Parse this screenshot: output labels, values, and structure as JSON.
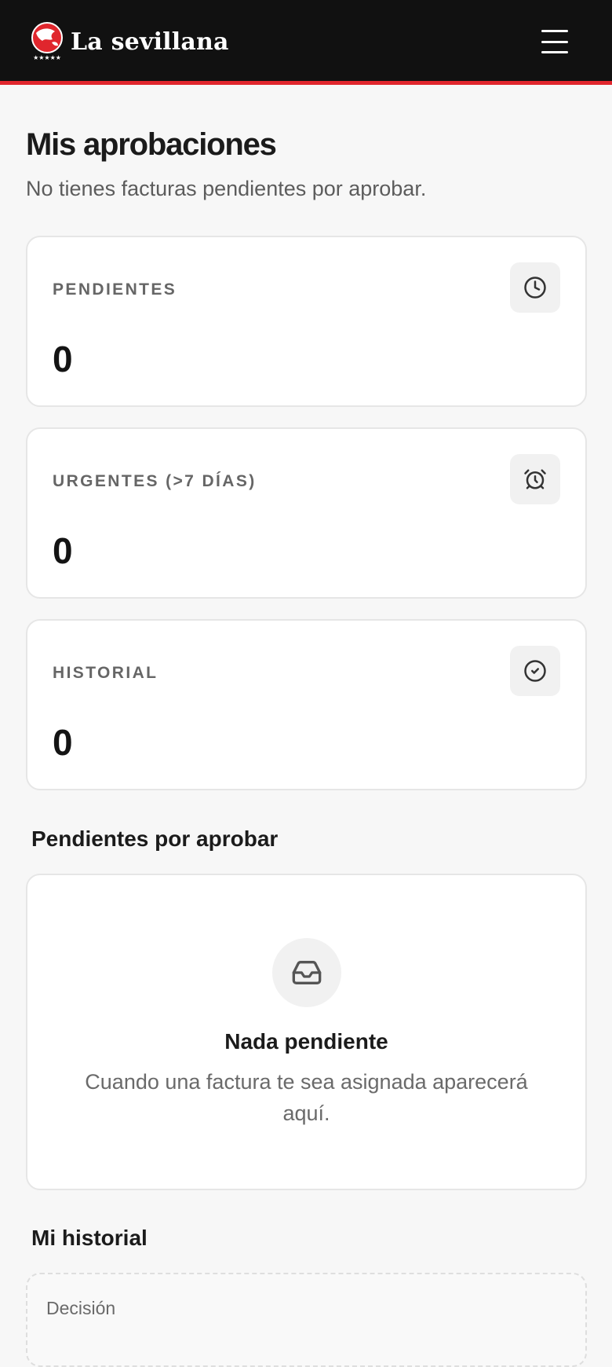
{
  "header": {
    "brand": "La sevillana",
    "colors": {
      "bar": "#111111",
      "accent": "#e0262d"
    },
    "menu_icon": "hamburger-menu-icon"
  },
  "page": {
    "title": "Mis aprobaciones",
    "subtitle": "No tienes facturas pendientes por aprobar."
  },
  "stats": [
    {
      "label": "PENDIENTES",
      "value": "0",
      "icon": "clock-icon"
    },
    {
      "label": "URGENTES (>7 DÍAS)",
      "value": "0",
      "icon": "alarm-clock-icon"
    },
    {
      "label": "HISTORIAL",
      "value": "0",
      "icon": "check-circle-icon"
    }
  ],
  "pending": {
    "section_title": "Pendientes por aprobar",
    "empty_icon": "inbox-icon",
    "empty_title": "Nada pendiente",
    "empty_desc": "Cuando una factura te sea asignada aparecerá aquí."
  },
  "history": {
    "section_title": "Mi historial",
    "column_header": "Decisión"
  }
}
